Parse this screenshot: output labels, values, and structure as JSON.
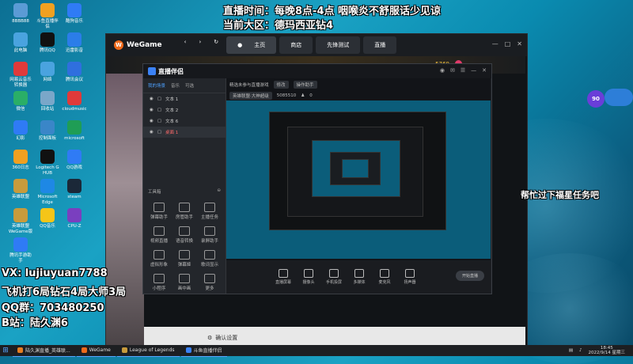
{
  "overlay": {
    "line1": "直播时间：每晚8点-4点    咽喉炎不舒服话少见谅",
    "line2": "当前大区：德玛西亚钻4",
    "contact1": "VX: lujiuyuan7788",
    "contact2": "飞机打6局钻石4局大师3局",
    "contact3": "QQ群：703480250",
    "contact4": "B站：陆久渊6",
    "right_msg": "帮忙过下福星任务吧"
  },
  "desktop_icons": [
    {
      "label": "8BBB88",
      "name": "icon-1",
      "color": "#5b9bd5"
    },
    {
      "label": "斗鱼直播伴侣",
      "name": "icon-2",
      "color": "#f0a020"
    },
    {
      "label": "酷狗音乐",
      "name": "icon-3",
      "color": "#2f7bf5"
    },
    {
      "label": "此电脑",
      "name": "icon-4",
      "color": "#4aa3df"
    },
    {
      "label": "腾讯QQ",
      "name": "icon-5",
      "color": "#111"
    },
    {
      "label": "迅雷影音",
      "name": "icon-6",
      "color": "#2b7de9"
    },
    {
      "label": "网易云音乐转换器",
      "name": "icon-7",
      "color": "#e03a3a"
    },
    {
      "label": "网络",
      "name": "icon-8",
      "color": "#4aa3df"
    },
    {
      "label": "腾讯会议",
      "name": "icon-9",
      "color": "#2f6fde"
    },
    {
      "label": "微信",
      "name": "icon-10",
      "color": "#2aae67"
    },
    {
      "label": "回收站",
      "name": "icon-11",
      "color": "#7aa7c9"
    },
    {
      "label": "cloudmusic",
      "name": "icon-12",
      "color": "#e03a3a"
    },
    {
      "label": "幻影",
      "name": "icon-13",
      "color": "#2f7bf5"
    },
    {
      "label": "控制面板",
      "name": "icon-14",
      "color": "#3a86c8"
    },
    {
      "label": "microsoft",
      "name": "icon-15",
      "color": "#1f9d55"
    },
    {
      "label": "360日志",
      "name": "icon-16",
      "color": "#f0a020"
    },
    {
      "label": "Logitech G HUB",
      "name": "icon-17",
      "color": "#111"
    },
    {
      "label": "QQ游戏",
      "name": "icon-18",
      "color": "#2f7bf5"
    },
    {
      "label": "英雄联盟",
      "name": "icon-19",
      "color": "#c89b3c"
    },
    {
      "label": "Microsoft Edge",
      "name": "icon-20",
      "color": "#1e88e5"
    },
    {
      "label": "steam",
      "name": "icon-21",
      "color": "#1b2838"
    },
    {
      "label": "英雄联盟WeGame版",
      "name": "icon-22",
      "color": "#c89b3c"
    },
    {
      "label": "QQ音乐",
      "name": "icon-23",
      "color": "#f5c518"
    },
    {
      "label": "CPU-Z",
      "name": "icon-24",
      "color": "#7a3fbf"
    },
    {
      "label": "腾讯手游助手",
      "name": "icon-25",
      "color": "#2f7bf5"
    }
  ],
  "wegame": {
    "logo": "WeGame",
    "tab_home": "主页",
    "tab_store": "商店",
    "tab_test": "先锋测试",
    "tab_live": "直播",
    "coins": "5769",
    "bottom_text": "确认设置"
  },
  "live": {
    "title": "直播伴侣",
    "tab_scenes": "我的场景",
    "tab_2": "音乐",
    "tab_3": "可选",
    "scenes": [
      "文本 1",
      "文本 2",
      "文本 6",
      "桌面 1"
    ],
    "tools_title": "工具箱",
    "tools": [
      "弹幕助手",
      "房管助手",
      "主播任务",
      "视频直播",
      "语音转换",
      "录屏助手",
      "虚拟形象",
      "弹幕姬",
      "歌词显示",
      "小程序",
      "画中画",
      "更多"
    ],
    "head_title": "精选未参与直播游戏",
    "head_chip1": "修改",
    "head_chip2": "操作助手",
    "head_chip3": "英雄联盟·大神超级",
    "head_id": "5085510",
    "head_count": "0",
    "bottom_buttons": [
      "直播屏幕",
      "摄像头",
      "手机投屏",
      "多媒体",
      "麦克风",
      "扬声器"
    ],
    "start_button": "开始直播"
  },
  "taskbar": {
    "item1": "陆久渊直播_英雄联...",
    "item2": "WeGame",
    "item3": "League of Legends",
    "item4": "斗鱼直播伴侣",
    "time": "18:45",
    "date": "2022/9/14 星期三"
  }
}
